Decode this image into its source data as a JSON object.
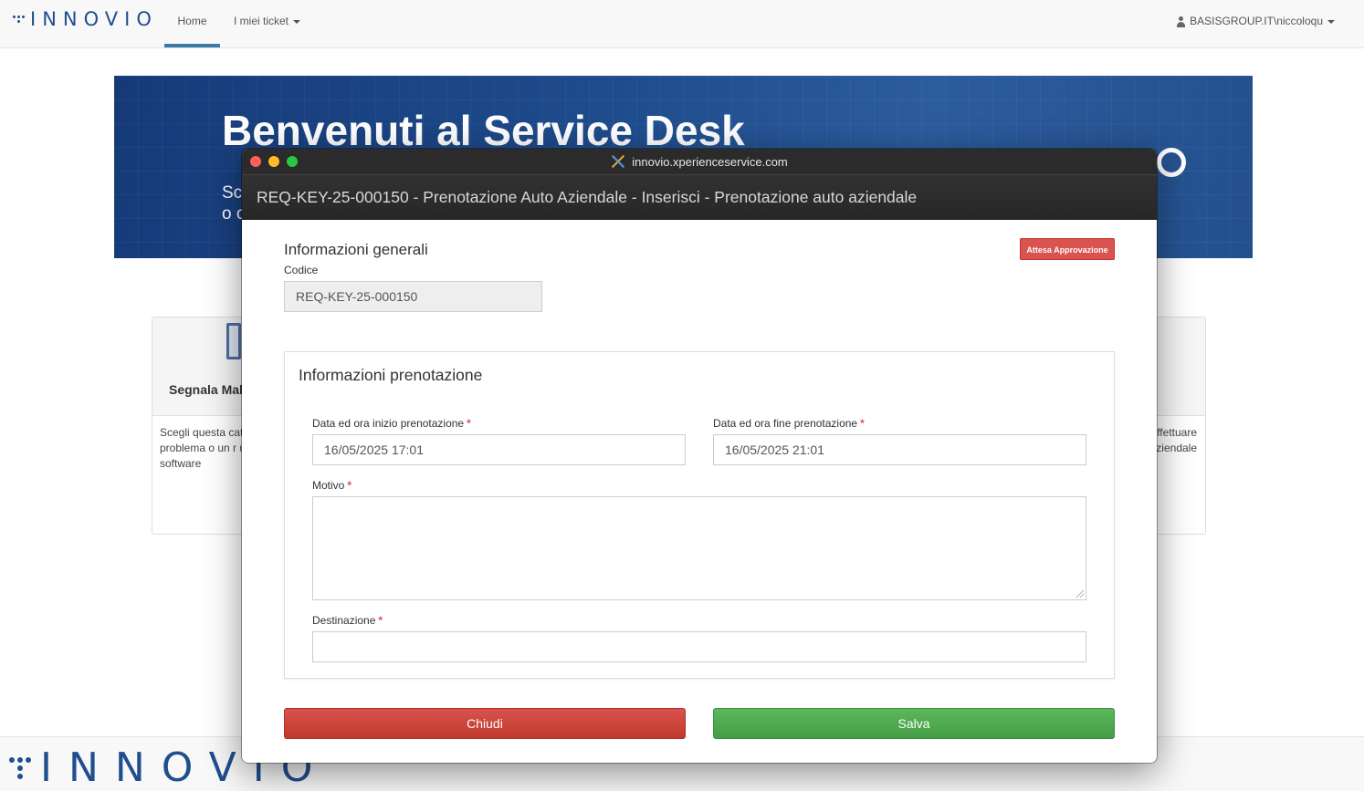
{
  "navbar": {
    "logo_text": "INNOVIO",
    "home": "Home",
    "my_tickets": "I miei ticket",
    "user": "BASISGROUP.IT\\niccoloqu"
  },
  "hero": {
    "title": "Benvenuti al Service Desk",
    "subtitle_line1": "Sc",
    "subtitle_line2": "o c"
  },
  "cards": {
    "left": {
      "title": "Segnala Mal",
      "text": "Scegli questa cat problema o un r un software"
    },
    "right": {
      "text_line1": "effettuare",
      "text_line2": "aziendale"
    }
  },
  "footer": {
    "logo_text": "INNOVIO"
  },
  "modal": {
    "url": "innovio.xperienceservice.com",
    "title": "REQ-KEY-25-000150 - Prenotazione Auto Aziendale - Inserisci - Prenotazione auto aziendale",
    "general_section": "Informazioni generali",
    "status": "Attesa Approvazione",
    "code_label": "Codice",
    "code_value": "REQ-KEY-25-000150",
    "booking_section": "Informazioni prenotazione",
    "start_label": "Data ed ora inizio prenotazione",
    "start_value": "16/05/2025 17:01",
    "end_label": "Data ed ora fine prenotazione",
    "end_value": "16/05/2025 21:01",
    "reason_label": "Motivo",
    "reason_value": "",
    "destination_label": "Destinazione",
    "destination_value": "",
    "required_mark": "*",
    "close_button": "Chiudi",
    "save_button": "Salva"
  },
  "colors": {
    "brand": "#1f4f8f",
    "danger": "#d9534f",
    "success": "#5cb85c",
    "titlebar": "#2b2b2b"
  }
}
